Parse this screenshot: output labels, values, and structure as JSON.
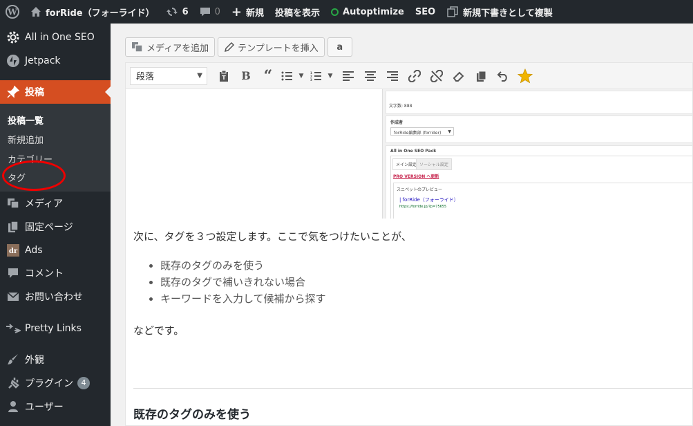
{
  "adminbar": {
    "site_name": "forRide（フォーライド）",
    "updates_count": "6",
    "comments_count": "0",
    "new_label": "新規",
    "view_post": "投稿を表示",
    "autoptimize": "Autoptimize",
    "seo": "SEO",
    "duplicate": "新規下書きとして複製"
  },
  "sidebar": {
    "items": [
      {
        "label": "All in One SEO",
        "icon": "gear-icon"
      },
      {
        "label": "Jetpack",
        "icon": "jetpack-icon"
      },
      {
        "label": "投稿",
        "icon": "pin-icon"
      },
      {
        "label": "メディア",
        "icon": "media-icon"
      },
      {
        "label": "固定ページ",
        "icon": "page-icon"
      },
      {
        "label": "Ads",
        "icon": "ads-icon"
      },
      {
        "label": "コメント",
        "icon": "comment-icon"
      },
      {
        "label": "お問い合わせ",
        "icon": "mail-icon"
      },
      {
        "label": "Pretty Links",
        "icon": "link-icon"
      },
      {
        "label": "外観",
        "icon": "brush-icon"
      },
      {
        "label": "プラグイン",
        "icon": "plugin-icon",
        "badge": "4"
      },
      {
        "label": "ユーザー",
        "icon": "user-icon"
      }
    ],
    "submenu": [
      "投稿一覧",
      "新規追加",
      "カテゴリー",
      "タグ"
    ],
    "annotation_color": "#ee0000"
  },
  "editor": {
    "add_media": "メディアを追加",
    "insert_template": "テンプレートを挿入",
    "amazon_label": "a",
    "format_select": "段落",
    "embedded_screenshot": {
      "chars": "文字数: 888",
      "author_heading": "作成者",
      "author_value": "forRide編集部 (forrider)",
      "aioseo_heading": "All in One SEO Pack",
      "tab_main": "メイン設定",
      "tab_social": "ソーシャル設定",
      "pro_link": "PRO VERSION へ更新",
      "snippet_heading": "スニペットのプレビュー",
      "snippet_title": "| forRide（フォーライド）",
      "snippet_url": "https://forride.jp/?p=75655"
    },
    "paragraph1": "次に、タグを３つ設定します。ここで気をつけたいことが、",
    "bullets": [
      "既存のタグのみを使う",
      "既存のタグで補いきれない場合",
      "キーワードを入力して候補から探す"
    ],
    "paragraph2": "などです。",
    "heading": "既存のタグのみを使う"
  },
  "colors": {
    "adminbar_bg": "#23282d",
    "current_menu": "#d54e21",
    "autoptimize_dot": "#28a745",
    "star": "#f0b400"
  }
}
